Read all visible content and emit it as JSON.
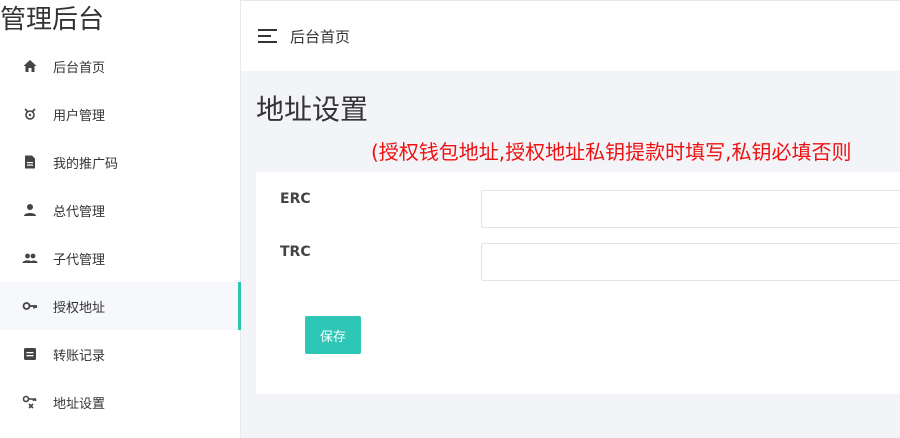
{
  "sidebar": {
    "brand": "管理后台",
    "items": [
      {
        "label": "后台首页",
        "icon": "home-icon"
      },
      {
        "label": "用户管理",
        "icon": "user-gear-icon"
      },
      {
        "label": "我的推广码",
        "icon": "document-icon"
      },
      {
        "label": "总代管理",
        "icon": "person-icon"
      },
      {
        "label": "子代管理",
        "icon": "people-icon"
      },
      {
        "label": "授权地址",
        "icon": "key-icon",
        "active": true
      },
      {
        "label": "转账记录",
        "icon": "list-box-icon"
      },
      {
        "label": "地址设置",
        "icon": "key-settings-icon"
      }
    ]
  },
  "header": {
    "title": "后台首页",
    "menu_icon": "hamburger-icon"
  },
  "main": {
    "title": "地址设置",
    "notice": "(授权钱包地址,授权地址私钥提款时填写,私钥必填否则",
    "form": {
      "erc_label": "ERC",
      "erc_value": "",
      "trc_label": "TRC",
      "trc_value": "",
      "save_label": "保存"
    }
  },
  "colors": {
    "accent": "#2ec7b6",
    "notice": "#ee1111",
    "background": "#f3f4f8"
  }
}
